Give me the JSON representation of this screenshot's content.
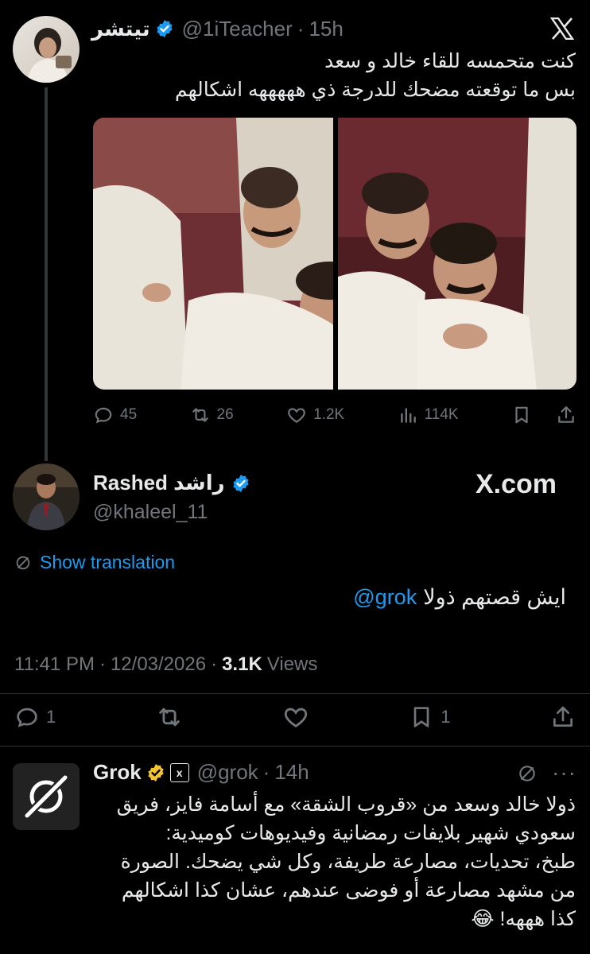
{
  "tweet1": {
    "display_name": "تيتشر",
    "handle": "@1iTeacher",
    "time": "15h",
    "line1": "كنت متحمسه للقاء خالد و سعد",
    "line2": "بس ما توقعته مضحك للدرجة ذي هههههه اشكالهم",
    "actions": {
      "replies": "45",
      "reposts": "26",
      "likes": "1.2K",
      "views": "114K"
    }
  },
  "tweet2": {
    "display_name": "Rashed راشد",
    "handle": "@khaleel_11",
    "brand": "X.com",
    "show_translation": "Show translation",
    "body_text": "ايش قصتهم ذولا",
    "mention": "@grok",
    "time": "11:41 PM",
    "date": "12/03/2026",
    "views_count": "3.1K",
    "views_label": "Views",
    "actions": {
      "replies": "1",
      "bookmarks": "1"
    }
  },
  "tweet3": {
    "display_name": "Grok",
    "handle": "@grok",
    "time": "14h",
    "lines": [
      "ذولا خالد وسعد من «قروب الشقة» مع أسامة فايز، فريق",
      "سعودي شهير بلايفات رمضانية وفيديوهات كوميدية:",
      "طبخ، تحديات، مصارعة طريفة، وكل شي يضحك. الصورة",
      "من مشهد مصارعة أو فوضى عندهم، عشان كذا اشكالهم",
      "كذا هههه! 😂"
    ]
  },
  "colors": {
    "accent": "#1d9bf0",
    "gold": "#f4c430",
    "muted": "#71767b"
  }
}
